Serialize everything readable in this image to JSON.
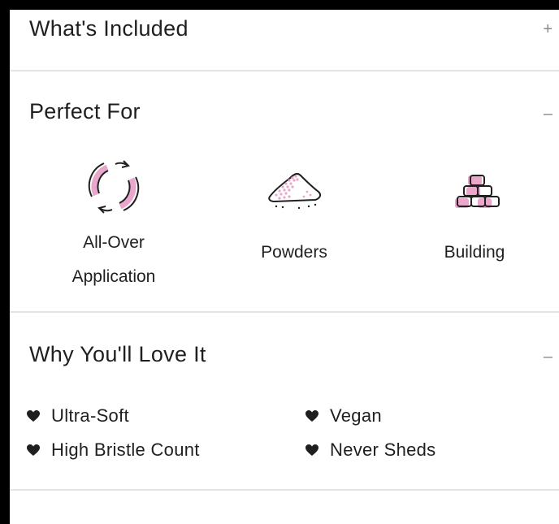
{
  "whats_included": {
    "title": "What's Included",
    "toggle": "+"
  },
  "perfect_for": {
    "title": "Perfect For",
    "toggle": "–",
    "items": [
      {
        "label_line1": "All-Over",
        "label_line2": "Application",
        "icon": "circular-arrows-icon"
      },
      {
        "label_line1": "Powders",
        "icon": "powder-pile-icon"
      },
      {
        "label_line1": "Building",
        "icon": "stacked-blocks-icon"
      }
    ]
  },
  "why_love": {
    "title": "Why You'll Love It",
    "toggle": "–",
    "bullets": [
      "Ultra-Soft",
      "High Bristle Count",
      "Vegan",
      "Never Sheds"
    ]
  },
  "colors": {
    "accent_pink": "#e8a7cb",
    "text": "#1f1f1f",
    "divider": "#e3e3e3"
  }
}
